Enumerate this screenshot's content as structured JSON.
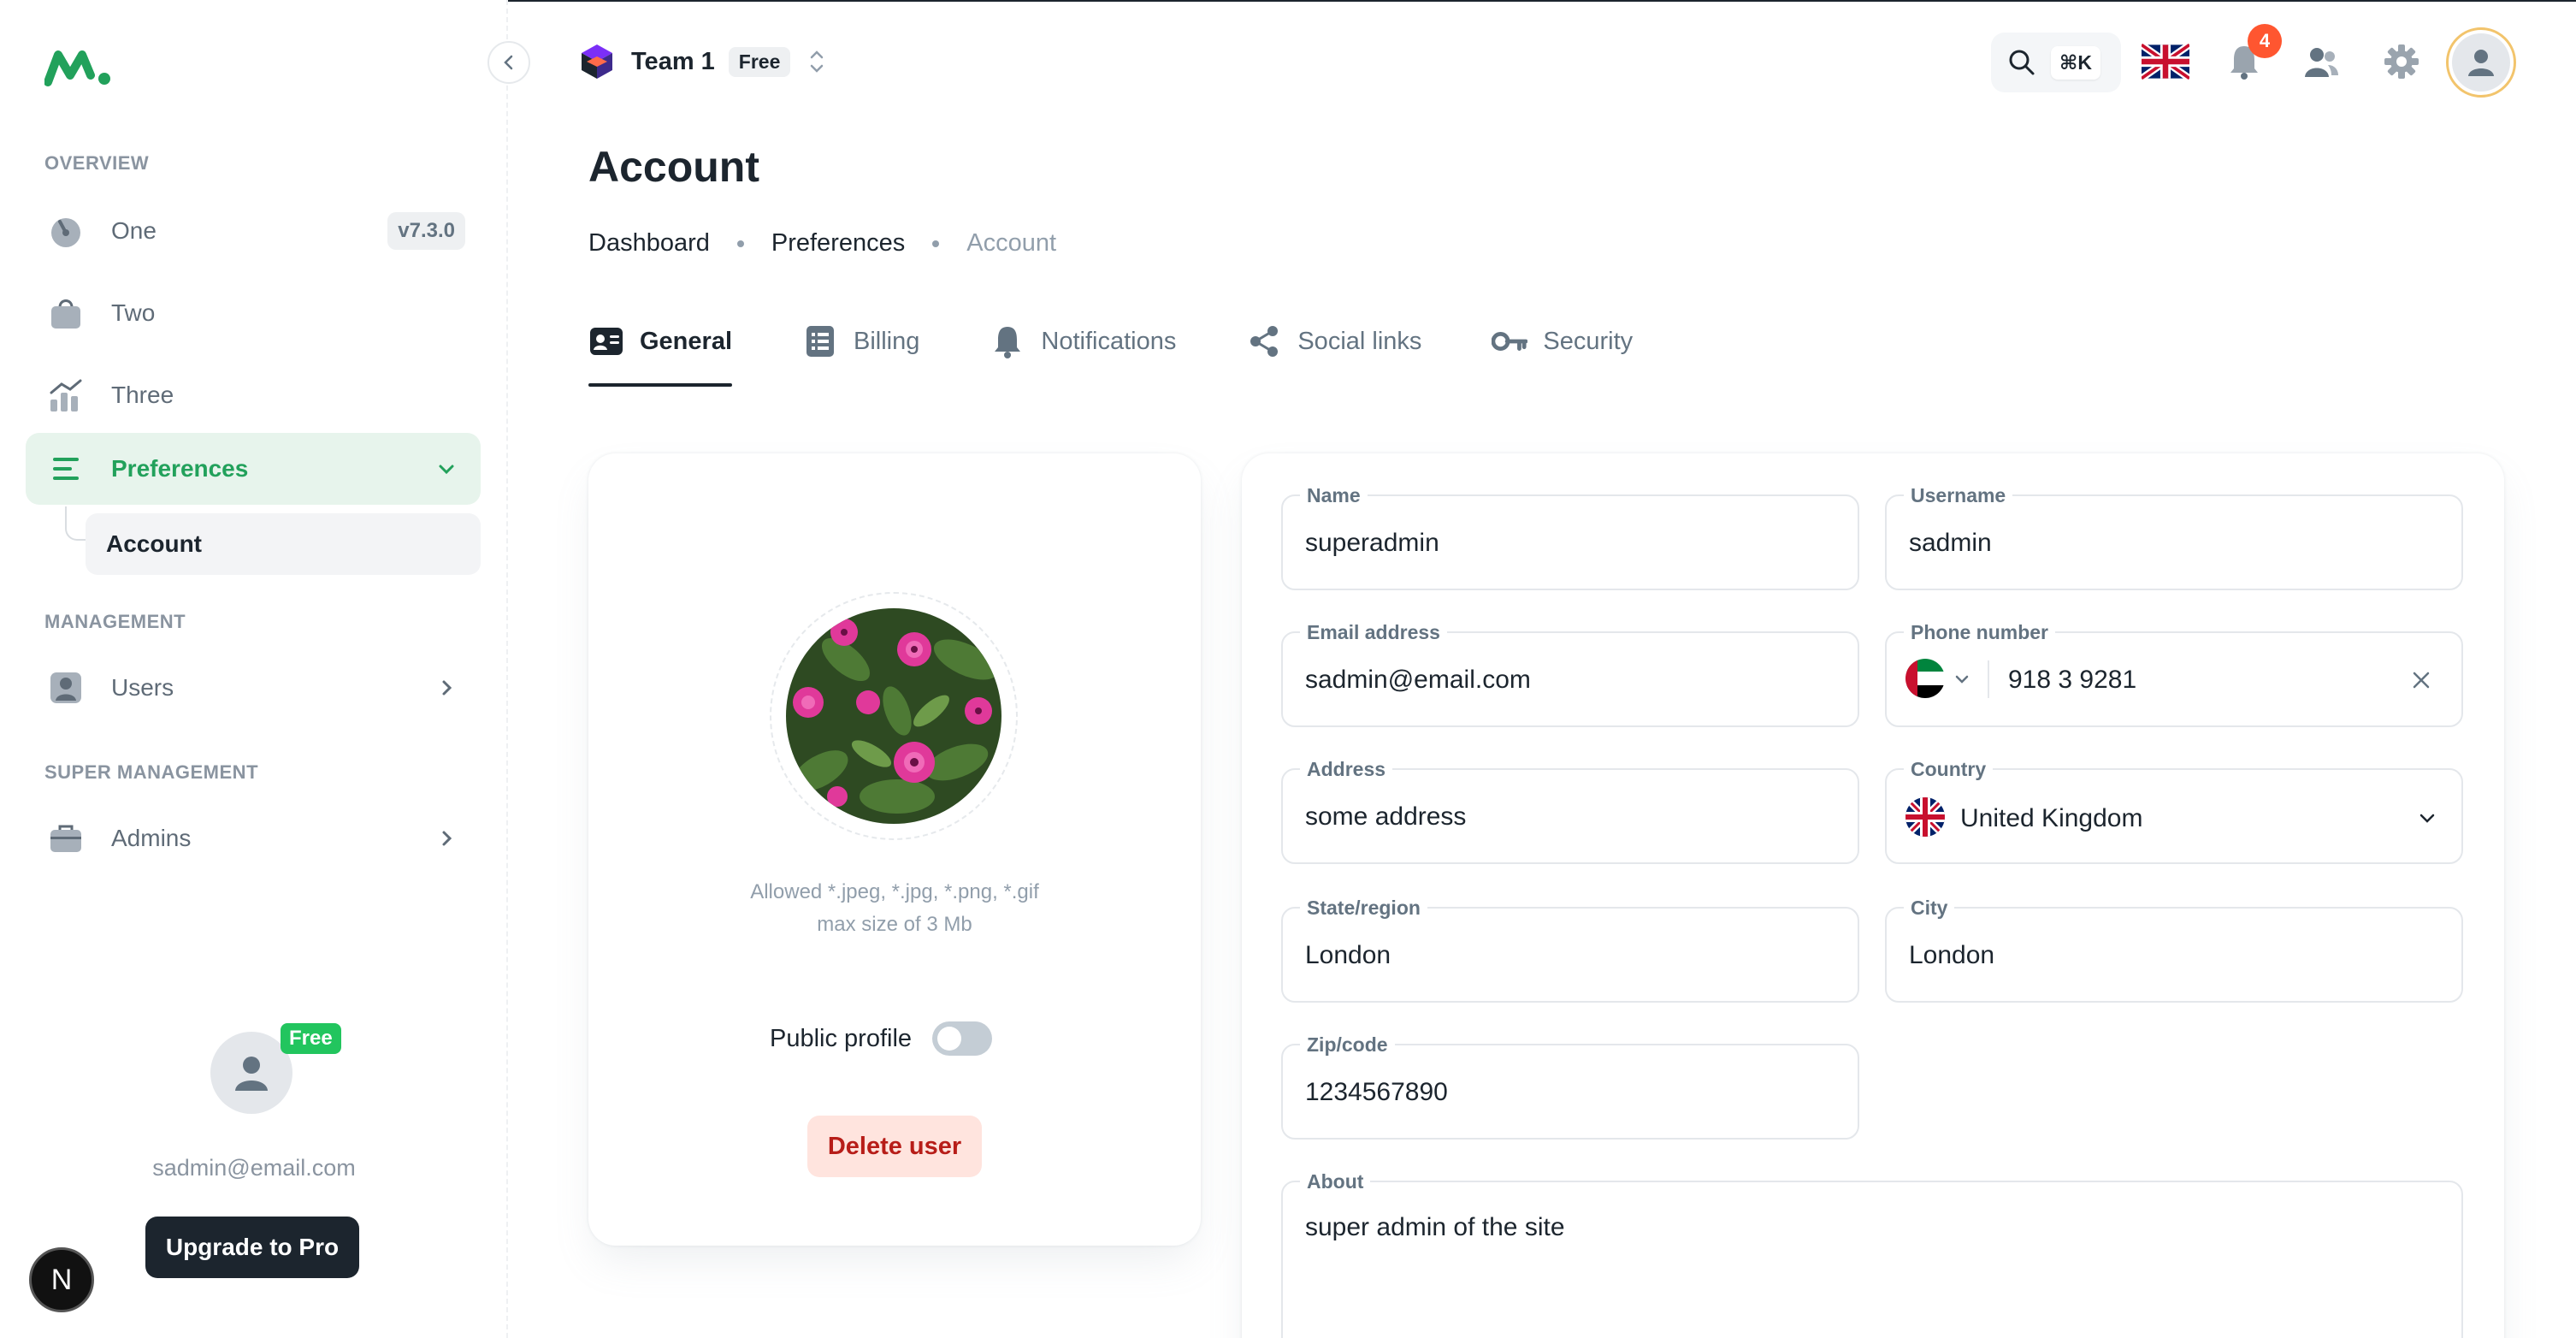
{
  "sidebar": {
    "sections": {
      "overview": "OVERVIEW",
      "management": "MANAGEMENT",
      "super_management": "SUPER MANAGEMENT"
    },
    "items": [
      {
        "label": "One",
        "icon": "dashboard-gauge-icon",
        "badge": "v7.3.0"
      },
      {
        "label": "Two",
        "icon": "shopping-bag-icon"
      },
      {
        "label": "Three",
        "icon": "analytics-chart-icon"
      },
      {
        "label": "Preferences",
        "icon": "preferences-lines-icon",
        "active": true
      },
      {
        "label": "Users",
        "icon": "user-icon"
      },
      {
        "label": "Admins",
        "icon": "briefcase-icon"
      }
    ],
    "sub_item": "Account",
    "user": {
      "plan": "Free",
      "email": "sadmin@email.com",
      "upgrade_label": "Upgrade to Pro"
    },
    "n_badge": "N"
  },
  "header": {
    "team_name": "Team 1",
    "team_plan": "Free",
    "search_shortcut": "⌘K",
    "notification_count": "4"
  },
  "page": {
    "title": "Account",
    "breadcrumb": [
      "Dashboard",
      "Preferences",
      "Account"
    ]
  },
  "tabs": [
    {
      "label": "General",
      "icon": "id-card-icon",
      "active": true
    },
    {
      "label": "Billing",
      "icon": "receipt-icon"
    },
    {
      "label": "Notifications",
      "icon": "bell-icon"
    },
    {
      "label": "Social links",
      "icon": "share-icon"
    },
    {
      "label": "Security",
      "icon": "key-icon"
    }
  ],
  "avatar_card": {
    "allowed_line1": "Allowed *.jpeg, *.jpg, *.png, *.gif",
    "allowed_line2": "max size of 3 Mb",
    "public_profile_label": "Public profile",
    "public_profile_on": false,
    "delete_label": "Delete user"
  },
  "form": {
    "name": {
      "label": "Name",
      "value": "superadmin"
    },
    "username": {
      "label": "Username",
      "value": "sadmin"
    },
    "email": {
      "label": "Email address",
      "value": "sadmin@email.com"
    },
    "phone": {
      "label": "Phone number",
      "value": "918 3 9281",
      "flag": "uae-flag-icon"
    },
    "address": {
      "label": "Address",
      "value": "some address"
    },
    "country": {
      "label": "Country",
      "value": "United Kingdom",
      "flag": "uk-flag-icon"
    },
    "state": {
      "label": "State/region",
      "value": "London"
    },
    "city": {
      "label": "City",
      "value": "London"
    },
    "zip": {
      "label": "Zip/code",
      "value": "1234567890"
    },
    "about": {
      "label": "About",
      "value": "super admin of the site"
    }
  },
  "colors": {
    "accent": "#22A15B",
    "active_bg": "#E7F4EC",
    "text_primary": "#1C252E",
    "text_secondary": "#637381",
    "danger": "#B71D18",
    "danger_bg": "#FFE4DE",
    "notification": "#FF5630",
    "free_badge": "#22C55E"
  }
}
